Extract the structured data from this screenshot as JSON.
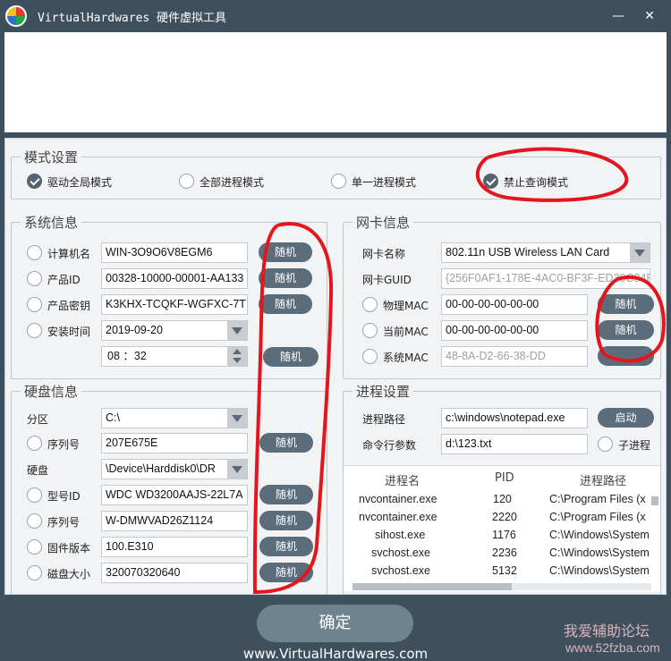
{
  "title": "VirtualHardwares 硬件虚拟工具",
  "window": {
    "minimize": "—",
    "close": "✕"
  },
  "mode": {
    "legend": "模式设置",
    "options": [
      {
        "label": "驱动全局模式",
        "checked": true
      },
      {
        "label": "全部进程模式",
        "checked": false
      },
      {
        "label": "单一进程模式",
        "checked": false
      },
      {
        "label": "禁止查询模式",
        "checked": true
      }
    ]
  },
  "system": {
    "legend": "系统信息",
    "computer_name": {
      "label": "计算机名",
      "value": "WIN-3O9O6V8EGM6"
    },
    "product_id": {
      "label": "产品ID",
      "value": "00328-10000-00001-AA133"
    },
    "product_key": {
      "label": "产品密钥",
      "value": "K3KHX-TCQKF-WGFXC-7T"
    },
    "install_time": {
      "label": "安装时间",
      "date": "2019-09-20",
      "time": "08 ：32"
    }
  },
  "disk": {
    "legend": "硬盘信息",
    "partition": {
      "label": "分区",
      "value": "C:\\"
    },
    "serial": {
      "label": "序列号",
      "value": "207E675E"
    },
    "harddisk": {
      "label": "硬盘",
      "value": "\\Device\\Harddisk0\\DR"
    },
    "model": {
      "label": "型号ID",
      "value": "WDC WD3200AAJS-22L7A"
    },
    "serial2": {
      "label": "序列号",
      "value": "W-DMWVAD26Z1124"
    },
    "firmware": {
      "label": "固件版本",
      "value": "100.E310"
    },
    "size": {
      "label": "磁盘大小",
      "value": "320070320640"
    }
  },
  "nic": {
    "legend": "网卡信息",
    "name": {
      "label": "网卡名称",
      "value": "802.11n USB Wireless LAN Card"
    },
    "guid": {
      "label": "网卡GUID",
      "value": "{256F0AF1-178E-4AC0-BF3F-ED30C84E"
    },
    "phys_mac": {
      "label": "物理MAC",
      "value": "00-00-00-00-00-00"
    },
    "cur_mac": {
      "label": "当前MAC",
      "value": "00-00-00-00-00-00"
    },
    "sys_mac": {
      "label": "系统MAC",
      "value": "48-8A-D2-66-38-DD"
    }
  },
  "process": {
    "legend": "进程设置",
    "path": {
      "label": "进程路径",
      "value": "c:\\windows\\notepad.exe"
    },
    "args": {
      "label": "命令行参数",
      "value": "d:\\123.txt"
    },
    "start_label": "启动",
    "child_label": "子进程",
    "table": {
      "headers": [
        "进程名",
        "PID",
        "进程路径"
      ],
      "rows": [
        [
          "nvcontainer.exe",
          "120",
          "C:\\Program Files (x"
        ],
        [
          "nvcontainer.exe",
          "2220",
          "C:\\Program Files (x"
        ],
        [
          "sihost.exe",
          "1176",
          "C:\\Windows\\System"
        ],
        [
          "svchost.exe",
          "2236",
          "C:\\Windows\\System"
        ],
        [
          "svchost.exe",
          "5132",
          "C:\\Windows\\System"
        ]
      ]
    }
  },
  "random_label": "随机",
  "ok_label": "确定",
  "footer": "www.VirtualHardwares.com",
  "watermark": {
    "line1": "我爱辅助论坛",
    "line2": "www.52fzba.com"
  },
  "colors": {
    "accent": "#5b6c7a",
    "titlebar": "#3e4f5d",
    "annotation": "#e3161e"
  }
}
